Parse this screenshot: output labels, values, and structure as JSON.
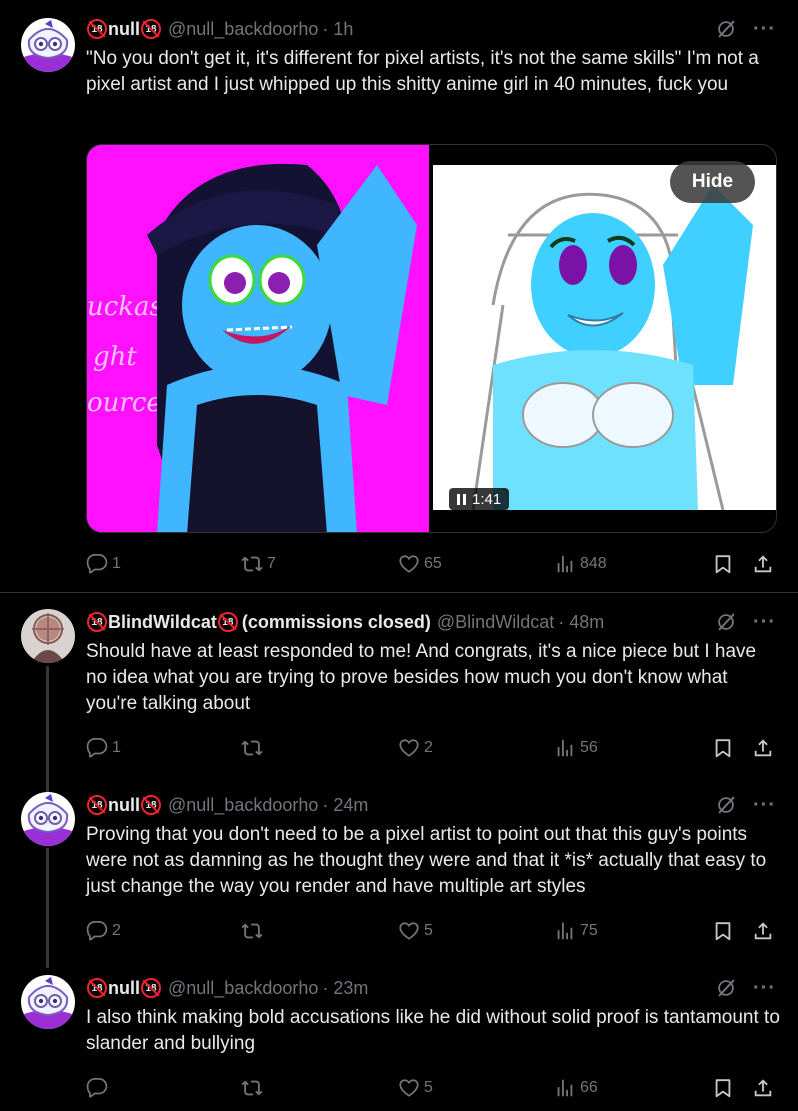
{
  "tweets": [
    {
      "badge_text": "18",
      "name": "null",
      "handle": "@null_backdoorho",
      "time": "· 1h",
      "text": "\"No you don't get it, it's different for pixel artists, it's not the same skills\" I'm not a pixel artist and I just whipped up this shitty anime girl in 40 minutes, fuck you",
      "replies": "1",
      "reposts": "7",
      "likes": "65",
      "views": "848"
    },
    {
      "badge_text": "18",
      "name": "BlindWildcat",
      "name_suffix": "(commissions closed)",
      "handle": "@BlindWildcat",
      "time": "· 48m",
      "text": "Should have at least responded to me! And congrats, it's a nice piece but I have no idea what you are trying to prove besides how much you don't know what you're talking about",
      "replies": "1",
      "reposts": "",
      "likes": "2",
      "views": "56"
    },
    {
      "badge_text": "18",
      "name": "null",
      "handle": "@null_backdoorho",
      "time": "· 24m",
      "text": "Proving that you don't need to be a pixel artist to point out that this guy's points were not as damning as he thought they were and that it *is* actually that easy to just change the way you render and have multiple art styles",
      "replies": "2",
      "reposts": "",
      "likes": "5",
      "views": "75"
    },
    {
      "badge_text": "18",
      "name": "null",
      "handle": "@null_backdoorho",
      "time": "· 23m",
      "text": "I also think making bold accusations like he did without solid proof is tantamount to slander and bullying",
      "replies": "",
      "reposts": "",
      "likes": "5",
      "views": "66"
    }
  ],
  "media": {
    "hide_label": "Hide",
    "video_time": "1:41",
    "left_image_text": [
      "uckass",
      "ght",
      "ource"
    ]
  },
  "colors": {
    "background": "#000000",
    "text": "#e7e9ea",
    "muted": "#71767b",
    "divider": "#2f3336",
    "badge": "#f4212e",
    "media_magenta": "#ff10ff"
  },
  "icons": [
    "reply-icon",
    "repost-icon",
    "like-icon",
    "views-icon",
    "bookmark-icon",
    "share-icon",
    "grok-icon",
    "more-icon"
  ]
}
